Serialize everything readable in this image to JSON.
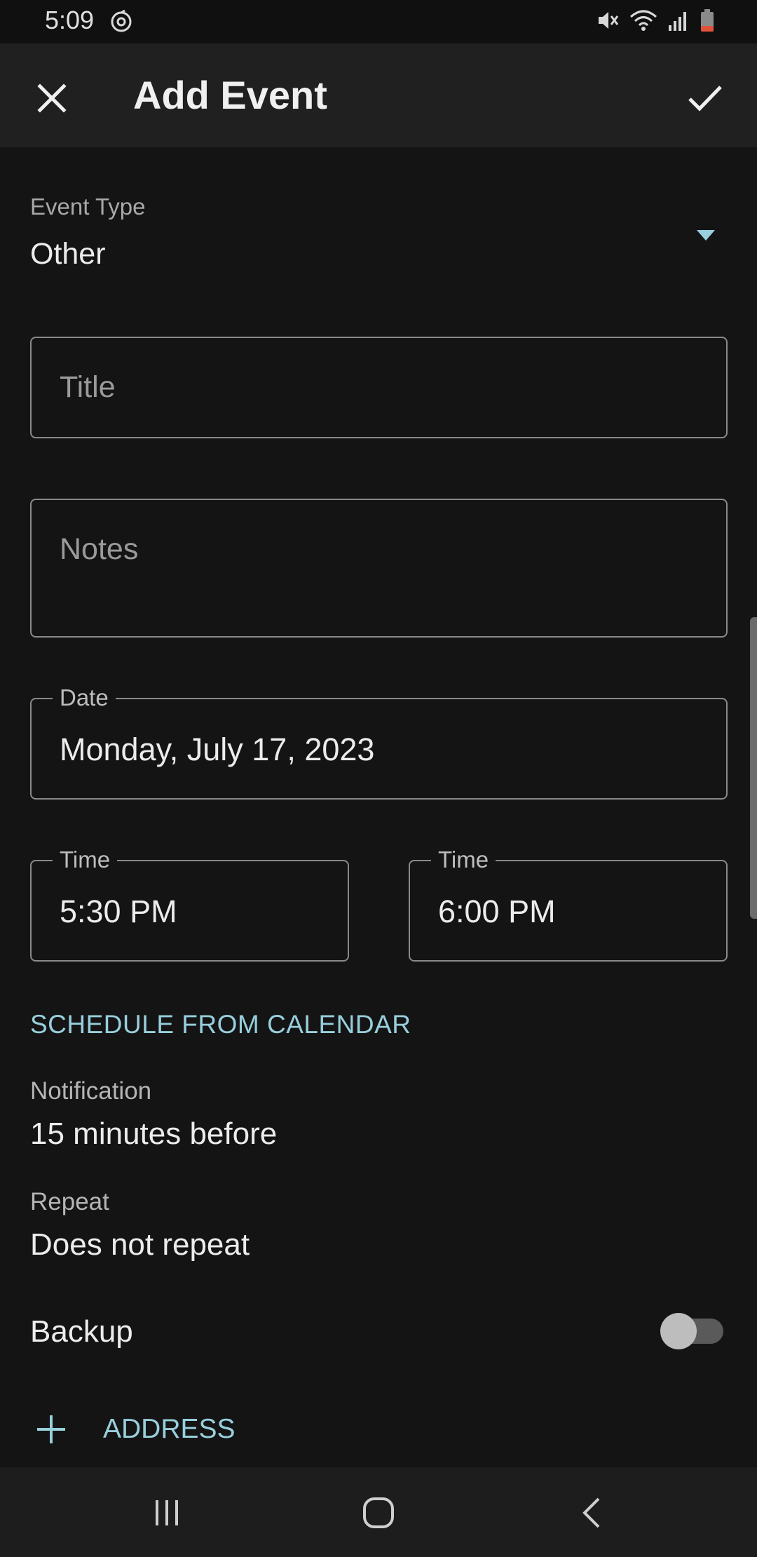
{
  "status_bar": {
    "time": "5:09",
    "icons": [
      "sync-icon",
      "mute-icon",
      "wifi-icon",
      "signal-icon",
      "battery-icon"
    ]
  },
  "app_bar": {
    "title": "Add Event",
    "close_icon": "close-icon",
    "save_icon": "check-icon"
  },
  "event_type": {
    "label": "Event Type",
    "value": "Other",
    "accent": "#98cfdc"
  },
  "fields": {
    "title_placeholder": "Title",
    "notes_placeholder": "Notes",
    "date_label": "Date",
    "date_value": "Monday, July 17, 2023",
    "start_time_label": "Time",
    "start_time_value": "5:30 PM",
    "end_time_label": "Time",
    "end_time_value": "6:00 PM"
  },
  "schedule_button": "SCHEDULE FROM CALENDAR",
  "notification": {
    "label": "Notification",
    "value": "15 minutes before"
  },
  "repeat": {
    "label": "Repeat",
    "value": "Does not repeat"
  },
  "backup": {
    "label": "Backup",
    "enabled": false
  },
  "address_button": "ADDRESS",
  "nav_bar": {
    "icons": [
      "recents-icon",
      "home-icon",
      "back-icon"
    ]
  },
  "colors": {
    "background": "#141415",
    "app_bar": "#202021",
    "accent": "#98cfdc",
    "battery_low": "#e0533a"
  }
}
